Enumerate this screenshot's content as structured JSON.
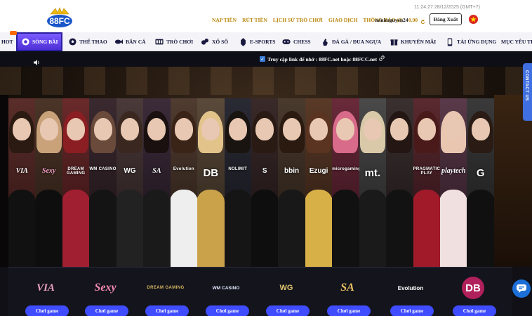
{
  "header": {
    "logo_text": "88FC",
    "datetime": "11:24:27 28/12/2025 (GMT+7)",
    "links": [
      "NẠP TIỀN",
      "RÚT TIỀN",
      "LỊCH SỬ TRÒ CHƠI",
      "GIAO DỊCH",
      "THÔNG BÁO (0)"
    ],
    "username": "minimguyen24",
    "balance": "0.00",
    "logout_label": "Đăng Xuất"
  },
  "nav": {
    "items": [
      {
        "label": "HOT",
        "icon": "hot-icon"
      },
      {
        "label": "SÒNG BÀI",
        "icon": "casino-chip-icon"
      },
      {
        "label": "THỂ THAO",
        "icon": "soccer-ball-icon"
      },
      {
        "label": "BẮN CÁ",
        "icon": "fish-icon"
      },
      {
        "label": "TRÒ CHƠI",
        "icon": "slot-machine-icon"
      },
      {
        "label": "XỔ SỐ",
        "icon": "lottery-balls-icon"
      },
      {
        "label": "E-SPORTS",
        "icon": "esports-icon"
      },
      {
        "label": "CHESS",
        "icon": "gamepad-icon"
      },
      {
        "label": "ĐÁ GÀ / ĐUA NGỰA",
        "icon": "rooster-icon"
      },
      {
        "label": "KHUYẾN MÃI",
        "icon": "gift-icon"
      },
      {
        "label": "TẢI ỨNG DỤNG",
        "icon": "phone-icon"
      },
      {
        "label": "MỤC YÊU TH",
        "icon": ""
      }
    ]
  },
  "announcement": {
    "text": "Truy cập link để nhớ : 88FC.net hoặc 88FCC.net"
  },
  "hero": {
    "providers": [
      "VIA",
      "Sexy",
      "DREAM GAMING",
      "WM CASINO",
      "WG",
      "SA",
      "Evolution",
      "DB",
      "NOLIMIT",
      "S",
      "bbin",
      "Ezugi",
      "microgaming",
      "mt.",
      "",
      "PRAGMATIC PLAY",
      "playtech",
      "G"
    ]
  },
  "side_tab": "CONTACT US",
  "cards": {
    "play_label": "Chơi game",
    "providers": [
      "VIA",
      "Sexy",
      "DREAM GAMING",
      "WM CASINO",
      "WG",
      "SA",
      "Evolution",
      "DB"
    ]
  },
  "colors": {
    "accent": "#4d2fd6",
    "gold": "#b8860b",
    "button_blue": "#3f4cff",
    "chat_blue": "#1d6fd8"
  }
}
